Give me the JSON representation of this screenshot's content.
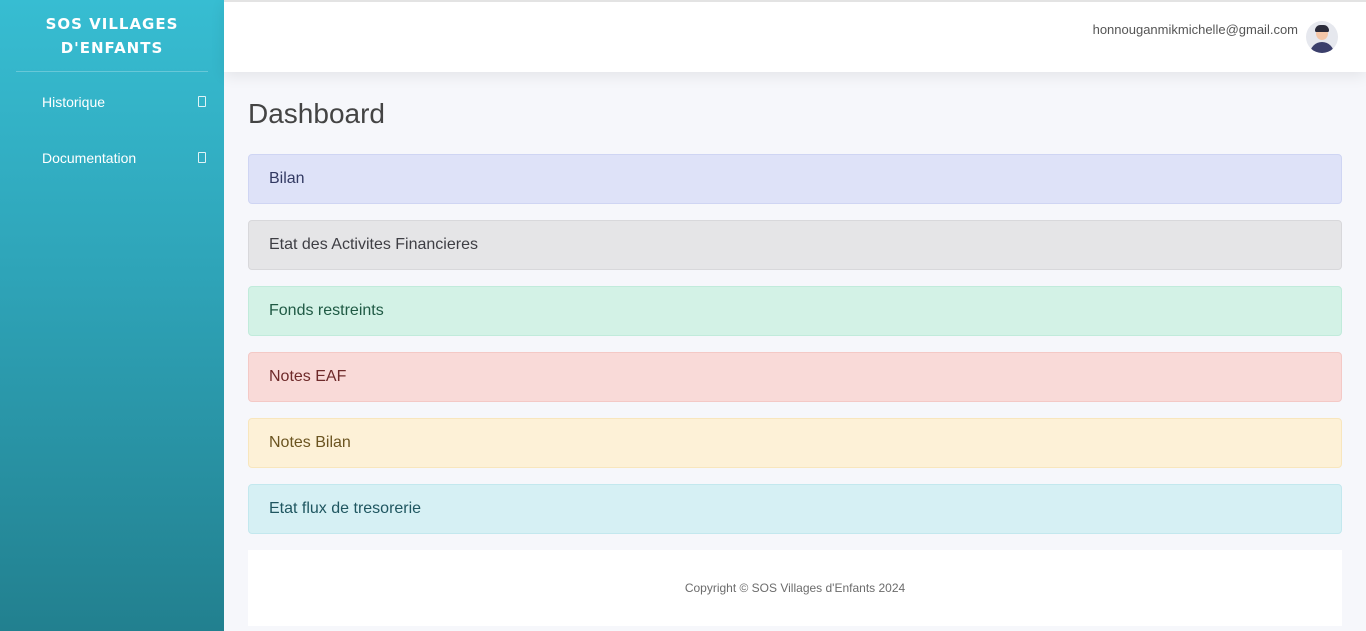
{
  "sidebar": {
    "brand": "SOS VILLAGES D'ENFANTS",
    "items": [
      {
        "label": "Historique",
        "icon": "square-icon"
      },
      {
        "label": "Documentation",
        "icon": "square-icon"
      }
    ]
  },
  "header": {
    "user_email": "honnouganmikmichelle@gmail.com",
    "avatar_icon": "user-avatar"
  },
  "main": {
    "title": "Dashboard",
    "cards": [
      {
        "label": "Bilan",
        "color": "#dee2f8"
      },
      {
        "label": "Etat des Activites Financieres",
        "color": "#e5e5e7"
      },
      {
        "label": "Fonds restreints",
        "color": "#d3f2e6"
      },
      {
        "label": "Notes EAF",
        "color": "#f9dad8"
      },
      {
        "label": "Notes Bilan",
        "color": "#fdf1d7"
      },
      {
        "label": "Etat flux de tresorerie",
        "color": "#d6f0f4"
      }
    ]
  },
  "footer": {
    "copyright": "Copyright © SOS Villages d'Enfants 2024"
  },
  "colors": {
    "sidebar_top": "#37bdd2",
    "sidebar_bottom": "#22808f"
  }
}
